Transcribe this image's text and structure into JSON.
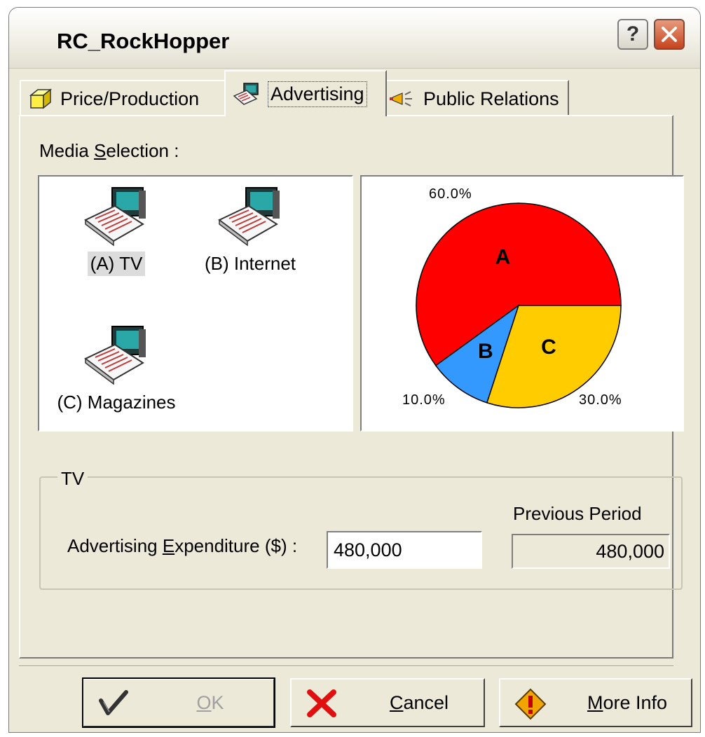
{
  "window": {
    "title": "RC_RockHopper",
    "help_label": "?"
  },
  "tabs": [
    {
      "label": "Price/Production",
      "icon": "box-icon",
      "selected": false
    },
    {
      "label": "Advertising",
      "icon": "advertising-icon",
      "selected": true
    },
    {
      "label": "Public Relations",
      "icon": "megaphone-icon",
      "selected": false
    }
  ],
  "media": {
    "label_pre": "Media ",
    "label_accel": "S",
    "label_post": "election :",
    "items": [
      {
        "label": "(A) TV",
        "icon": "computer-newspaper-icon",
        "selected": true
      },
      {
        "label": "(B) Internet",
        "icon": "computer-newspaper-icon",
        "selected": false
      },
      {
        "label": "(C) Magazines",
        "icon": "computer-newspaper-icon",
        "selected": false
      }
    ]
  },
  "chart_data": {
    "type": "pie",
    "slices": [
      {
        "label": "A",
        "value": 60.0,
        "display": "60.0%",
        "color": "#ff0000"
      },
      {
        "label": "B",
        "value": 10.0,
        "display": "10.0%",
        "color": "#3399ff"
      },
      {
        "label": "C",
        "value": 30.0,
        "display": "30.0%",
        "color": "#ffcc00"
      }
    ]
  },
  "group": {
    "title": "TV",
    "expenditure_pre": "Advertising ",
    "expenditure_accel": "E",
    "expenditure_post": "xpenditure ($) :",
    "expenditure_value": "480,000",
    "previous_label": "Previous Period",
    "previous_value": "480,000"
  },
  "buttons": {
    "ok_accel": "O",
    "ok_rest": "K",
    "cancel_accel": "C",
    "cancel_rest": "ancel",
    "more_accel": "M",
    "more_rest": "ore Info"
  },
  "colors": {
    "accent_red": "#ff0000",
    "accent_blue": "#3399ff",
    "accent_yellow": "#ffcc00"
  }
}
